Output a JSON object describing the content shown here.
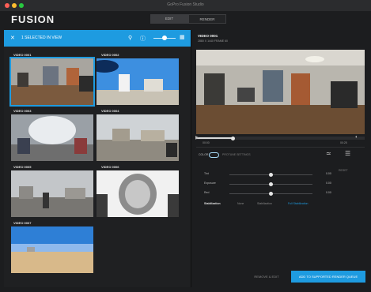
{
  "window": {
    "title": "GoPro Fusion Studio"
  },
  "logo": {
    "text": "FUSION"
  },
  "mode_tabs": [
    {
      "label": "EDIT"
    },
    {
      "label": "RENDER"
    }
  ],
  "toolbar": {
    "label": "1 SELECTED IN VIEW",
    "icons": [
      "close-icon",
      "filter-icon",
      "info-icon",
      "zoom-slider",
      "grid-icon"
    ]
  },
  "thumbnails": [
    {
      "label": "VIDEO 0001",
      "scene": "room",
      "selected": true
    },
    {
      "label": "VIDEO 0002",
      "scene": "sky"
    },
    {
      "label": "VIDEO 0003",
      "scene": "tunnel"
    },
    {
      "label": "VIDEO 0004",
      "scene": "plaza"
    },
    {
      "label": "VIDEO 0005",
      "scene": "street"
    },
    {
      "label": "VIDEO 0006",
      "scene": "orb"
    },
    {
      "label": "VIDEO 0007",
      "scene": "beach"
    }
  ],
  "media": {
    "title": "VIDEO 0001",
    "subtitle": "2880 X 1440   FRAME 60"
  },
  "player": {
    "time_start": "00:00",
    "time_end": "00:25",
    "progress": 0.22
  },
  "controls": {
    "toggle_label": "COLOR",
    "toggle_desc": "PROTUNE SETTINGS",
    "side_label": "RESET",
    "sliders": [
      {
        "label": "Tint",
        "value": "0.00",
        "level": 0.5
      },
      {
        "label": "Exposure",
        "value": "0.00",
        "level": 0.5
      },
      {
        "label": "Red",
        "value": "0.00",
        "level": 0.5
      }
    ],
    "stabilization": {
      "label": "Stabilization",
      "options": [
        "None",
        "Stabilization",
        "Full Stabilization"
      ],
      "selected": "Full Stabilization"
    }
  },
  "footer": {
    "secondary": "REMOVE & EDIT",
    "primary": "ADD TO SUPPORTED RENDER QUEUE"
  },
  "colors": {
    "accent": "#1e9be0",
    "bg": "#1c1d1f"
  }
}
